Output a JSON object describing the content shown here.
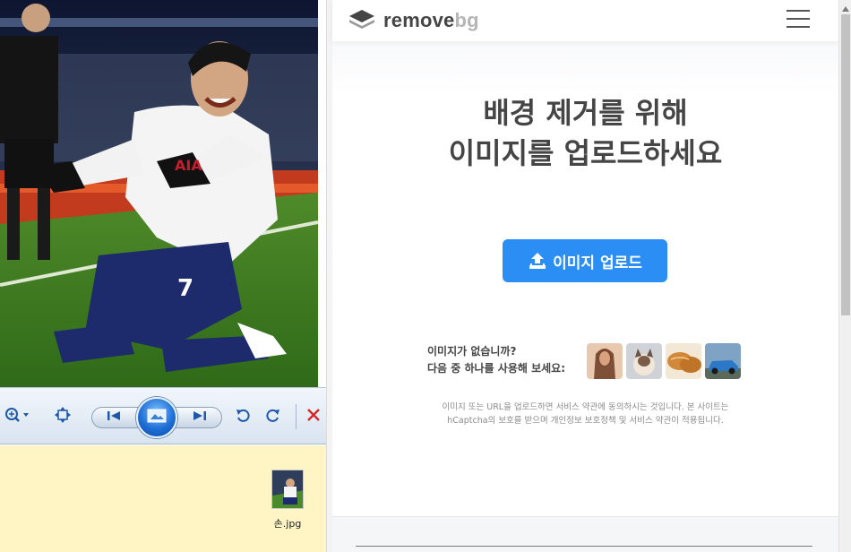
{
  "viewer": {
    "file_name": "손.jpg",
    "toolbar": {
      "zoom_icon": "magnifier-zoom-icon",
      "fit_icon": "actual-size-icon",
      "prev_icon": "previous-icon",
      "slideshow_icon": "slideshow-icon",
      "next_icon": "next-icon",
      "rotate_left_icon": "rotate-ccw-icon",
      "rotate_right_icon": "rotate-cw-icon",
      "delete_icon": "delete-x-icon"
    }
  },
  "browser": {
    "logo": {
      "main": "remove",
      "accent": "bg"
    },
    "headline": {
      "line1": "배경 제거를 위해",
      "line2": "이미지를 업로드하세요"
    },
    "upload_button": "이미지 업로드",
    "samples": {
      "line1": "이미지가 없습니까?",
      "line2": "다음 중 하나를 사용해 보세요:"
    },
    "terms": {
      "line1": "이미지 또는 URL을 업로드하면 서비스 약관에 동의하시는 것입니다. 본 사이트는",
      "line2": "hCaptcha의 보호를 받으며 개인정보 보호정책 및 서비스 약관이 적용됩니다."
    }
  },
  "colors": {
    "accent": "#2b8ef5",
    "text": "#454545",
    "desktop": "#fff4c4"
  }
}
